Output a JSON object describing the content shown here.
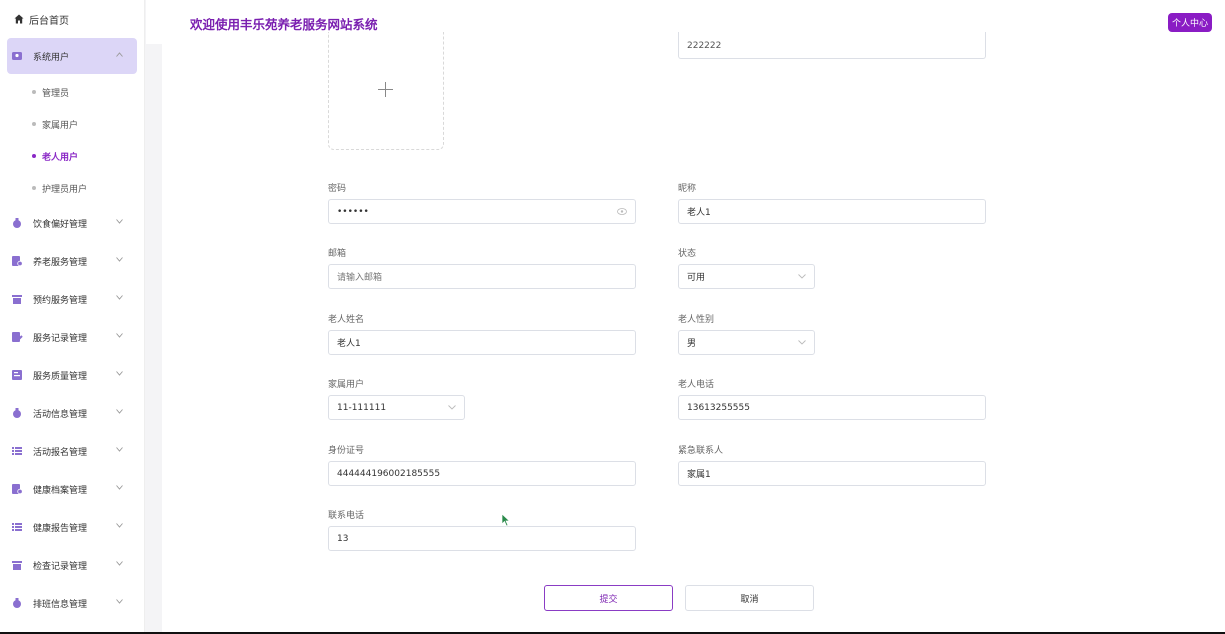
{
  "header": {
    "title": "欢迎使用丰乐苑养老服务网站系统",
    "user_center": "个人中心"
  },
  "sidebar": {
    "home": "后台首页",
    "active_group": "系统用户",
    "sub_items": [
      "管理员",
      "家属用户",
      "老人用户",
      "护理员用户"
    ],
    "current_sub": "老人用户",
    "groups": [
      "饮食偏好管理",
      "养老服务管理",
      "预约服务管理",
      "服务记录管理",
      "服务质量管理",
      "活动信息管理",
      "活动报名管理",
      "健康档案管理",
      "健康报告管理",
      "检查记录管理",
      "排班信息管理"
    ]
  },
  "form": {
    "top_field_value": "222222",
    "password_label": "密码",
    "password_value": "••••••",
    "nickname_label": "昵称",
    "nickname_value": "老人1",
    "email_label": "邮箱",
    "email_placeholder": "请输入邮箱",
    "status_label": "状态",
    "status_value": "可用",
    "elder_name_label": "老人姓名",
    "elder_name_value": "老人1",
    "elder_gender_label": "老人性别",
    "elder_gender_value": "男",
    "family_user_label": "家属用户",
    "family_user_value": "11-111111",
    "elder_phone_label": "老人电话",
    "elder_phone_value": "13613255555",
    "id_card_label": "身份证号",
    "id_card_value": "444444196002185555",
    "emergency_contact_label": "紧急联系人",
    "emergency_contact_value": "家属1",
    "contact_phone_label": "联系电话",
    "contact_phone_value": "13",
    "submit_label": "提交",
    "cancel_label": "取消"
  },
  "colors": {
    "accent": "#8a1cc4",
    "title": "#7a1fb0",
    "active_bg": "#dcd6f7"
  }
}
